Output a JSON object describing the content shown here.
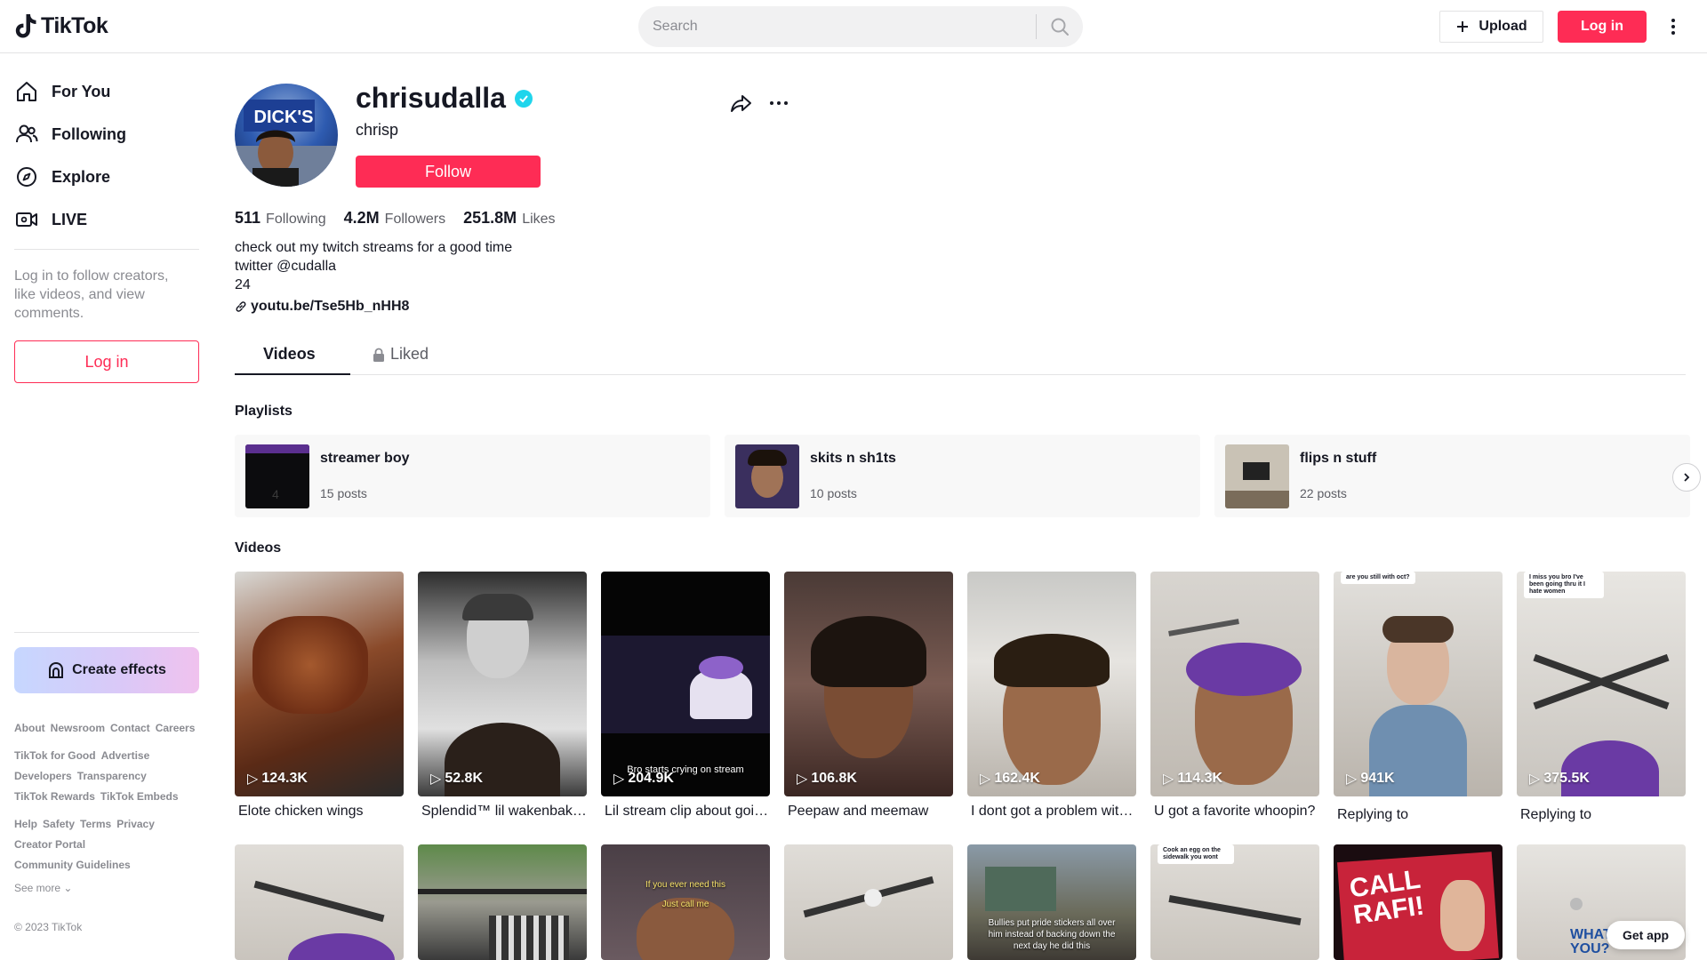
{
  "header": {
    "logo_text": "TikTok",
    "search_placeholder": "Search",
    "upload_label": "Upload",
    "login_label": "Log in"
  },
  "sidebar": {
    "nav": [
      {
        "label": "For You",
        "icon": "home-icon"
      },
      {
        "label": "Following",
        "icon": "users-icon"
      },
      {
        "label": "Explore",
        "icon": "compass-icon"
      },
      {
        "label": "LIVE",
        "icon": "live-icon"
      }
    ],
    "login_note": "Log in to follow creators, like videos, and view comments.",
    "login_label": "Log in",
    "create_effects_label": "Create effects",
    "footer_rows": [
      [
        "About",
        "Newsroom",
        "Contact",
        "Careers"
      ],
      [
        "TikTok for Good",
        "Advertise"
      ],
      [
        "Developers",
        "Transparency"
      ],
      [
        "TikTok Rewards",
        "TikTok Embeds"
      ],
      [
        "Help",
        "Safety",
        "Terms",
        "Privacy"
      ],
      [
        "Creator Portal"
      ],
      [
        "Community Guidelines"
      ]
    ],
    "see_more": "See more",
    "copyright": "© 2023 TikTok"
  },
  "profile": {
    "username": "chrisudalla",
    "nickname": "chrisp",
    "follow_label": "Follow",
    "stats": {
      "following": "511",
      "following_label": "Following",
      "followers": "4.2M",
      "followers_label": "Followers",
      "likes": "251.8M",
      "likes_label": "Likes"
    },
    "bio_lines": [
      "check out my twitch streams for a good time",
      "twitter @cudalla",
      "24"
    ],
    "link": "youtu.be/Tse5Hb_nHH8"
  },
  "tabs": {
    "videos": "Videos",
    "liked": "Liked"
  },
  "playlists": {
    "title": "Playlists",
    "items": [
      {
        "name": "streamer boy",
        "count": "15 posts"
      },
      {
        "name": "skits n sh1ts",
        "count": "10 posts"
      },
      {
        "name": "flips n stuff",
        "count": "22 posts"
      }
    ]
  },
  "videos": {
    "title": "Videos",
    "row1": [
      {
        "views": "124.3K",
        "caption": "Elote chicken wings"
      },
      {
        "views": "52.8K",
        "caption": "Splendid™ lil wakenbake sesh"
      },
      {
        "views": "204.9K",
        "caption": "Lil stream clip about going through it",
        "overlay": "Bro starts crying on stream"
      },
      {
        "views": "106.8K",
        "caption": "Peepaw and meemaw"
      },
      {
        "views": "162.4K",
        "caption": "I dont got a problem with it"
      },
      {
        "views": "114.3K",
        "caption": "U got a favorite whoopin?"
      },
      {
        "views": "941K",
        "caption": "Replying to",
        "bubble": "are you still with oct?"
      },
      {
        "views": "375.5K",
        "caption": "Replying to",
        "bubble": "I miss you bro I've been going thru it I hate women"
      }
    ],
    "row2_overlays": {
      "v3_line1": "If you ever need this",
      "v3_line2": "Just call me",
      "v5": "Bullies put pride stickers all over him instead of backing down the next day he did this",
      "v6_bubble": "Cook an egg on the sidewalk you wont",
      "v7_sign1": "CALL",
      "v7_sign2": "RAFI!",
      "v8": "WHAT ARE YOU?"
    }
  },
  "get_app": "Get app",
  "colors": {
    "accent": "#fe2c55",
    "verified": "#20d5ec",
    "text": "#161823",
    "muted": "#8a8b91"
  }
}
